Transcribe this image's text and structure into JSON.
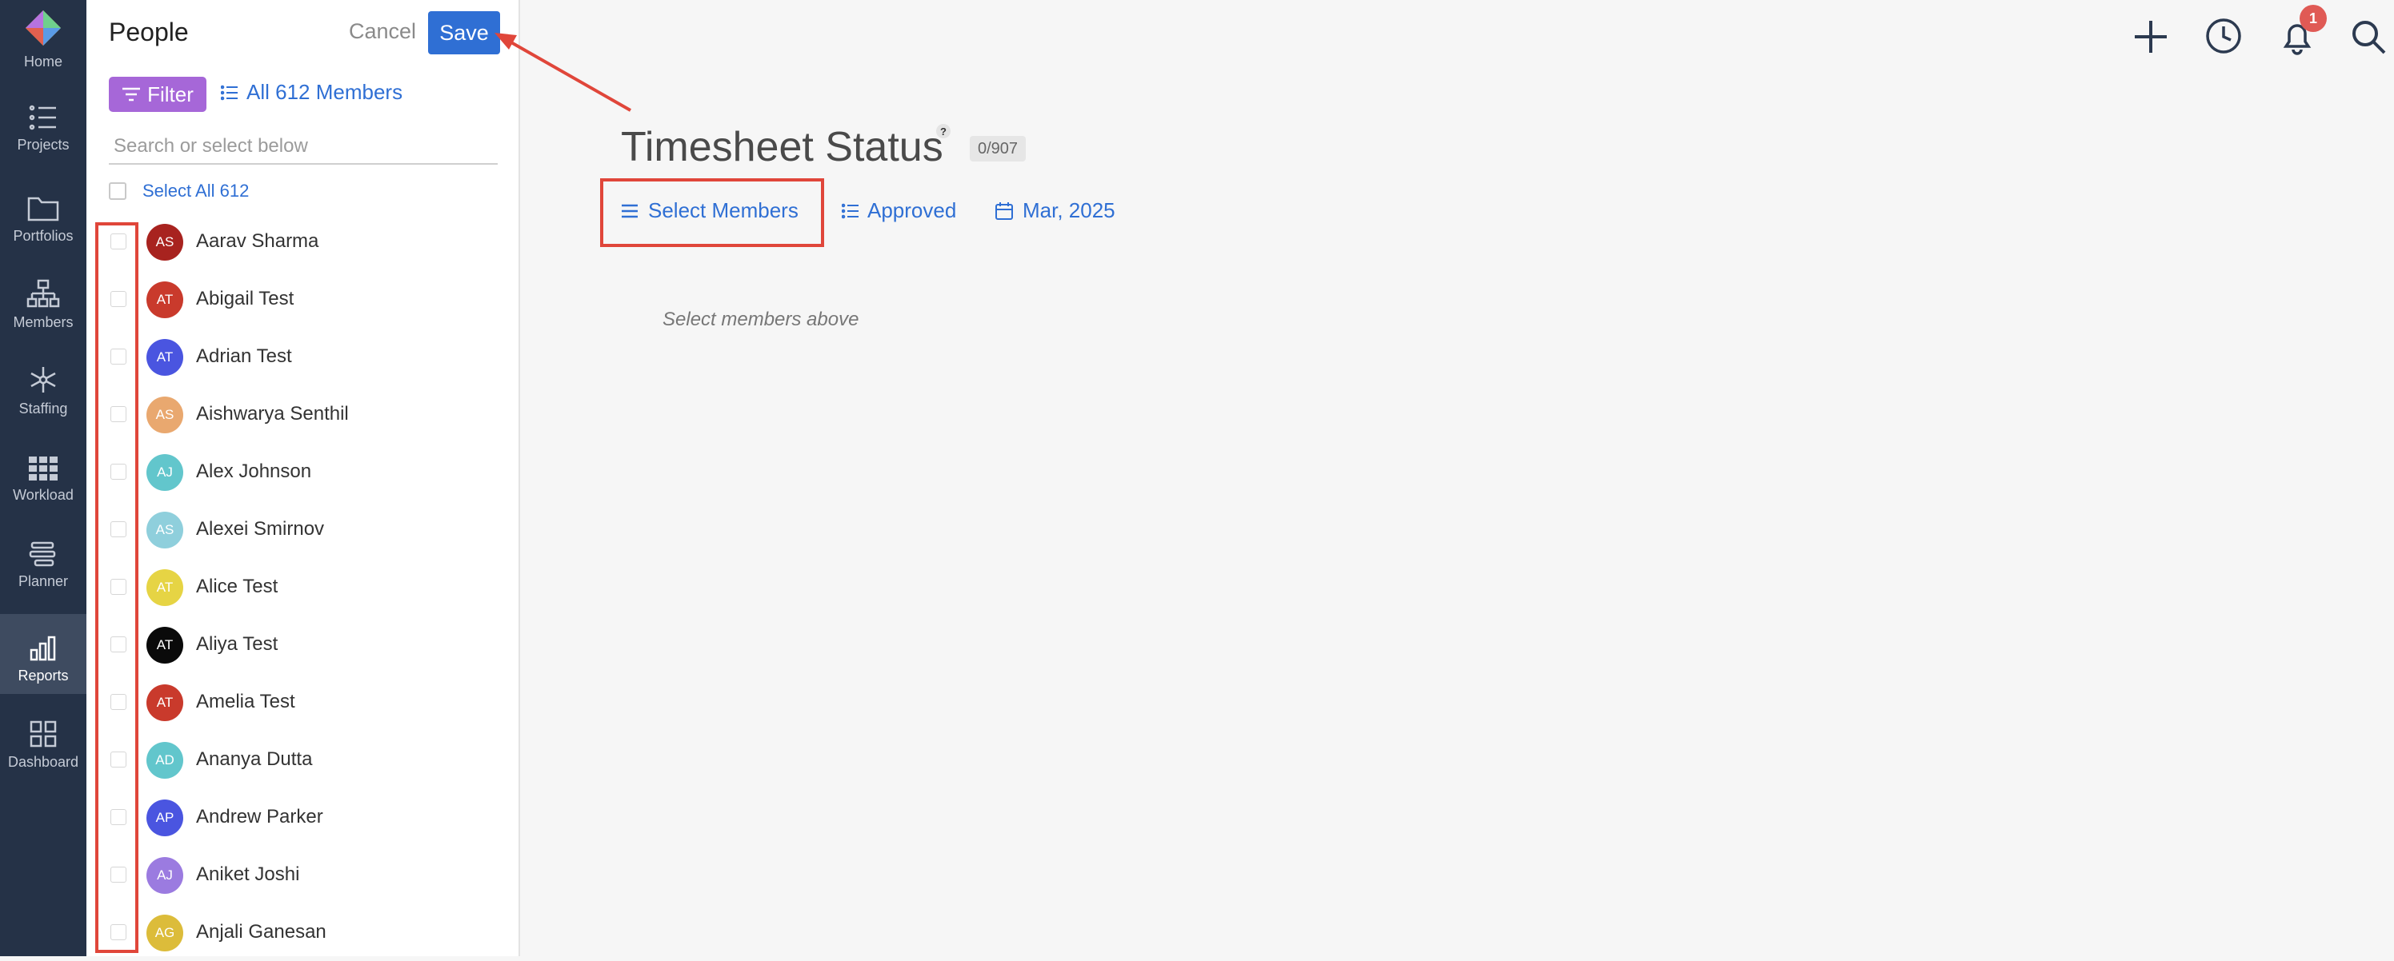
{
  "nav": {
    "items": [
      {
        "label": "Home",
        "icon": "home-logo-icon"
      },
      {
        "label": "Projects",
        "icon": "list-icon"
      },
      {
        "label": "Portfolios",
        "icon": "folder-icon"
      },
      {
        "label": "Members",
        "icon": "org-chart-icon"
      },
      {
        "label": "Staffing",
        "icon": "network-icon"
      },
      {
        "label": "Workload",
        "icon": "grid-icon"
      },
      {
        "label": "Planner",
        "icon": "planner-icon"
      },
      {
        "label": "Reports",
        "icon": "bar-chart-icon",
        "active": true
      },
      {
        "label": "Dashboard",
        "icon": "dashboard-icon"
      }
    ]
  },
  "panel": {
    "title": "People",
    "cancel_label": "Cancel",
    "save_label": "Save",
    "filter_label": "Filter",
    "all_members_label": "All 612 Members",
    "search_placeholder": "Search or select below",
    "select_all_label": "Select All 612",
    "members": [
      {
        "initials": "AS",
        "name": "Aarav Sharma",
        "color": "#a8231f"
      },
      {
        "initials": "AT",
        "name": "Abigail Test",
        "color": "#c93a2c"
      },
      {
        "initials": "AT",
        "name": "Adrian Test",
        "color": "#4a55e0"
      },
      {
        "initials": "AS",
        "name": "Aishwarya Senthil",
        "color": "#e9a86f"
      },
      {
        "initials": "AJ",
        "name": "Alex Johnson",
        "color": "#62c6cc"
      },
      {
        "initials": "AS",
        "name": "Alexei Smirnov",
        "color": "#8fcfdc"
      },
      {
        "initials": "AT",
        "name": "Alice Test",
        "color": "#e6d444"
      },
      {
        "initials": "AT",
        "name": "Aliya Test",
        "color": "#0a0a0a"
      },
      {
        "initials": "AT",
        "name": "Amelia Test",
        "color": "#c93a2c"
      },
      {
        "initials": "AD",
        "name": "Ananya Dutta",
        "color": "#62c6cc"
      },
      {
        "initials": "AP",
        "name": "Andrew Parker",
        "color": "#4a55e0"
      },
      {
        "initials": "AJ",
        "name": "Aniket Joshi",
        "color": "#9b7be0"
      },
      {
        "initials": "AG",
        "name": "Anjali Ganesan",
        "color": "#dcbc3a"
      }
    ]
  },
  "main": {
    "title": "Timesheet Status",
    "help_glyph": "?",
    "count_badge": "0/907",
    "select_members_label": "Select Members",
    "approved_label": "Approved",
    "date_label": "Mar, 2025",
    "empty_message": "Select members above"
  },
  "header": {
    "notification_count": "1"
  },
  "colors": {
    "accent": "#2f6fd4",
    "filter": "#a667d8",
    "nav_bg": "#253247",
    "annotation": "#e0463a"
  }
}
